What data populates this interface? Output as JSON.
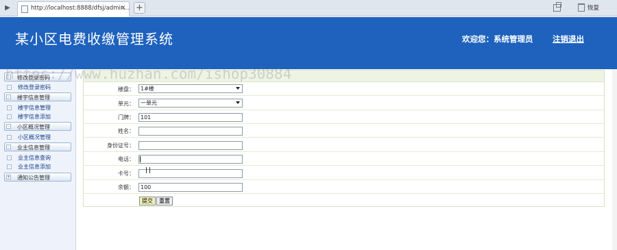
{
  "browser": {
    "tab_url": "http://localhost:8888/dfsj/admin...",
    "tab_close": "×",
    "new_tab": "+",
    "restore_label": "恢复"
  },
  "header": {
    "title": "某小区电费收缴管理系统",
    "welcome": "欢迎您：系统管理员",
    "logout": "注销退出",
    "background": "#1e62bd"
  },
  "watermark": "https://www.huzhan.com/ishop30884",
  "sidebar": {
    "groups": [
      {
        "label": "修改登录密码",
        "items": [
          "修改登录密码"
        ]
      },
      {
        "label": "楼宇信息管理",
        "items": [
          "楼宇信息管理",
          "楼宇信息添加"
        ]
      },
      {
        "label": "小区概况管理",
        "items": [
          "小区概况管理"
        ]
      },
      {
        "label": "业主信息管理",
        "items": [
          "业主信息查询",
          "业主信息添加"
        ]
      },
      {
        "label": "通知公告管理",
        "items": []
      }
    ]
  },
  "form": {
    "fields": [
      {
        "label": "楼盘：",
        "type": "select",
        "value": "1#楼"
      },
      {
        "label": "单元：",
        "type": "select",
        "value": "一单元"
      },
      {
        "label": "门牌：",
        "type": "input",
        "value": "101"
      },
      {
        "label": "姓名：",
        "type": "input",
        "value": ""
      },
      {
        "label": "身份证号：",
        "type": "input",
        "value": ""
      },
      {
        "label": "电话：",
        "type": "input",
        "value": ""
      },
      {
        "label": "卡号：",
        "type": "input",
        "value": ""
      },
      {
        "label": "余额：",
        "type": "input",
        "value": "100"
      }
    ],
    "submit_label": "提交",
    "reset_label": "重置"
  }
}
